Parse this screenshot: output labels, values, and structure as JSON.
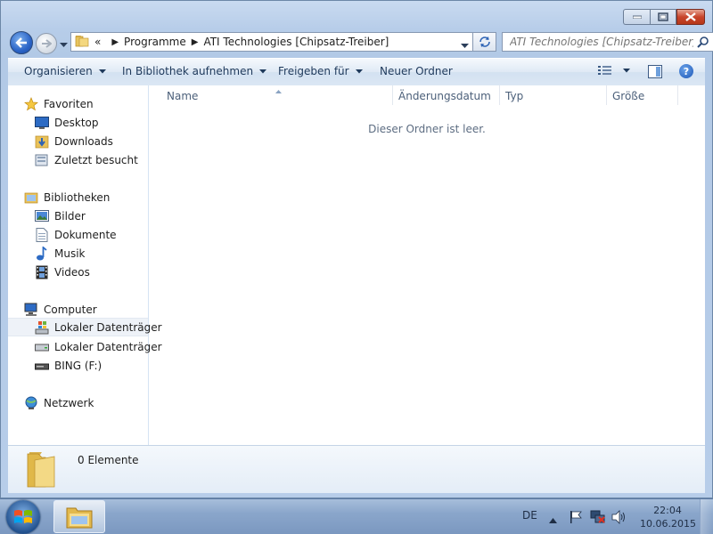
{
  "window": {
    "caption": {
      "minimize": "minimize",
      "maximize": "maximize",
      "close": "close"
    }
  },
  "nav": {
    "breadcrumb_overflow": "«",
    "breadcrumb": [
      "Programme",
      "ATI Technologies [Chipsatz-Treiber]"
    ],
    "search_placeholder": "ATI Technologies [Chipsatz-Treiber] ..."
  },
  "toolbar": {
    "organize": "Organisieren",
    "include_library": "In Bibliothek aufnehmen",
    "share": "Freigeben für",
    "new_folder": "Neuer Ordner",
    "help": "?"
  },
  "sidebar": {
    "favorites": {
      "label": "Favoriten",
      "items": [
        "Desktop",
        "Downloads",
        "Zuletzt besucht"
      ]
    },
    "libraries": {
      "label": "Bibliotheken",
      "items": [
        "Bilder",
        "Dokumente",
        "Musik",
        "Videos"
      ]
    },
    "computer": {
      "label": "Computer",
      "items": [
        "Lokaler Datenträger",
        "Lokaler Datenträger",
        "BING (F:)"
      ]
    },
    "network": {
      "label": "Netzwerk"
    }
  },
  "filelist": {
    "columns": [
      "Name",
      "Änderungsdatum",
      "Typ",
      "Größe"
    ],
    "empty_message": "Dieser Ordner ist leer."
  },
  "details": {
    "count": "0 Elemente"
  },
  "taskbar": {
    "language": "DE",
    "time": "22:04",
    "date": "10.06.2015"
  },
  "colors": {
    "accent": "#1e395b",
    "window_frame": "#b7cde9",
    "close_button": "#c8452c",
    "selected_item": "#eef2f8"
  },
  "icons": {
    "favorites": "star-icon",
    "desktop": "desktop-icon",
    "downloads": "downloads-folder-icon",
    "recent": "recent-places-icon",
    "libraries": "libraries-icon",
    "pictures": "pictures-icon",
    "documents": "documents-icon",
    "music": "music-note-icon",
    "videos": "video-film-icon",
    "computer": "computer-icon",
    "drive_system": "windows-drive-icon",
    "drive": "hard-drive-icon",
    "usb": "usb-drive-icon",
    "network": "network-icon"
  }
}
